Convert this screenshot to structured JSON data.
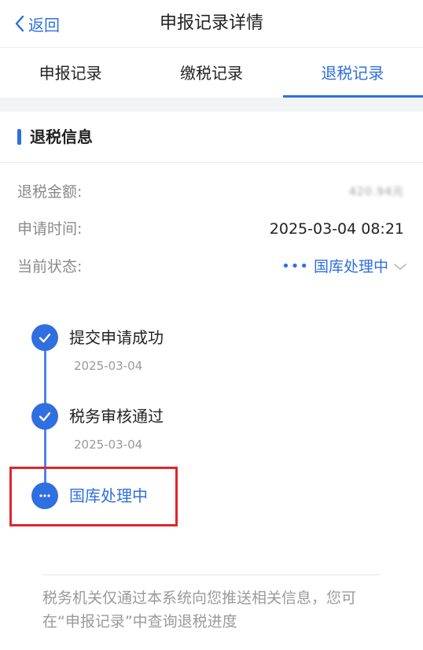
{
  "header": {
    "back_label": "返回",
    "title": "申报记录详情"
  },
  "tabs": [
    {
      "label": "申报记录",
      "active": false
    },
    {
      "label": "缴税记录",
      "active": false
    },
    {
      "label": "退税记录",
      "active": true
    }
  ],
  "section": {
    "title": "退税信息"
  },
  "info": {
    "amount_label": "退税金额:",
    "amount_value": "420.94元",
    "time_label": "申请时间:",
    "time_value": "2025-03-04 08:21",
    "status_label": "当前状态:",
    "status_value": "国库处理中"
  },
  "timeline": [
    {
      "title": "提交申请成功",
      "date": "2025-03-04",
      "state": "done"
    },
    {
      "title": "税务审核通过",
      "date": "2025-03-04",
      "state": "done"
    },
    {
      "title": "国库处理中",
      "date": "",
      "state": "current"
    }
  ],
  "footer": {
    "note": "税务机关仅通过本系统向您推送相关信息，您可在“申报记录”中查询退税进度"
  },
  "colors": {
    "accent": "#2f6fe0",
    "highlight": "#e0252b"
  },
  "icons": {
    "back": "chevron-left-icon",
    "done": "check-icon",
    "current": "ellipsis-icon",
    "status_dropdown": "chevron-down-icon"
  }
}
